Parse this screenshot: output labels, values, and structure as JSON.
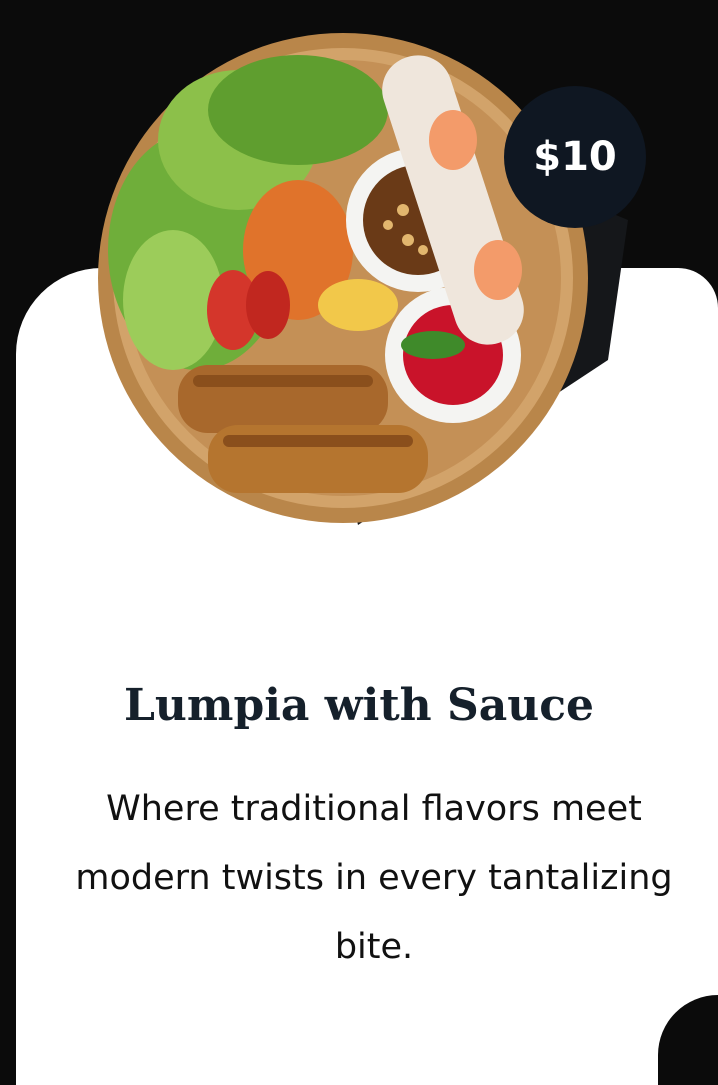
{
  "menu_item": {
    "price": "$10",
    "title": "Lumpia with Sauce",
    "description": "Where traditional flavors meet modern twists in every tantalizing bite."
  }
}
